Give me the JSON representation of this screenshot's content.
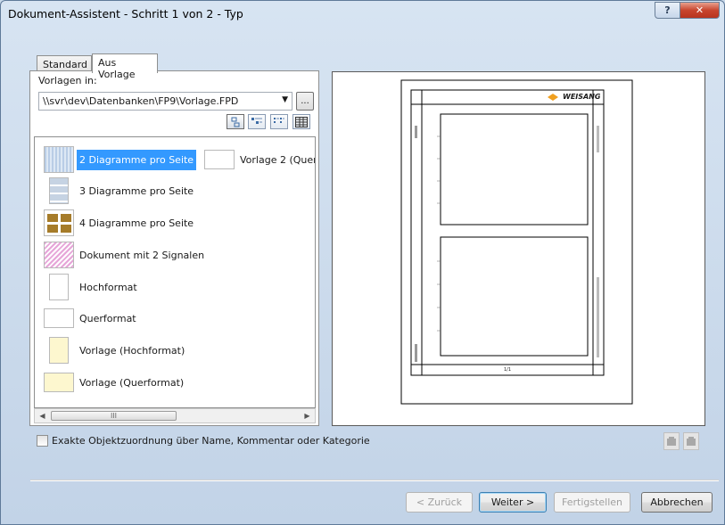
{
  "window": {
    "title": "Dokument-Assistent - Schritt 1 von 2 - Typ",
    "help_icon": "question-icon",
    "close_icon": "close-icon"
  },
  "tabs": [
    {
      "label": "Standard",
      "active": false
    },
    {
      "label": "Aus Vorlage",
      "active": true
    }
  ],
  "templates_folder": {
    "label": "Vorlagen in:",
    "path": "\\\\svr\\dev\\Datenbanken\\FP9\\Vorlage.FPD",
    "browse_label": "..."
  },
  "view_buttons": [
    {
      "icon": "large-icons-view-icon"
    },
    {
      "icon": "small-icons-view-icon"
    },
    {
      "icon": "list-view-icon"
    },
    {
      "icon": "details-view-icon"
    }
  ],
  "templates": [
    {
      "label": "2 Diagramme pro Seite",
      "icon": "two-charts-thumb",
      "selected": true
    },
    {
      "label": "Vorlage 2  (Quer",
      "icon": "landscape-blank-thumb",
      "selected": false
    },
    {
      "label": "3 Diagramme pro Seite",
      "icon": "three-charts-thumb",
      "selected": false
    },
    {
      "label": "4 Diagramme pro Seite",
      "icon": "four-charts-thumb",
      "selected": false
    },
    {
      "label": "Dokument mit 2 Signalen",
      "icon": "signals-thumb",
      "selected": false
    },
    {
      "label": "Hochformat",
      "icon": "portrait-thumb",
      "selected": false
    },
    {
      "label": "Querformat",
      "icon": "landscape-thumb",
      "selected": false
    },
    {
      "label": "Vorlage (Hochformat)",
      "icon": "portrait-yellow-thumb",
      "selected": false
    },
    {
      "label": "Vorlage (Querformat)",
      "icon": "landscape-yellow-thumb",
      "selected": false
    }
  ],
  "scrollbar": {
    "thumb_grip": "III"
  },
  "preview": {
    "logo_text": "WEISANG",
    "page_number": "1/1"
  },
  "exact_assignment_label": "Exakte Objektzuordnung über Name, Kommentar oder Kategorie",
  "buttons": {
    "back": "< Zurück",
    "next": "Weiter >",
    "finish": "Fertigstellen",
    "cancel": "Abbrechen"
  },
  "colors": {
    "selection": "#3399ff",
    "close_button": "#c8452e",
    "logo_orange": "#f0a020"
  }
}
